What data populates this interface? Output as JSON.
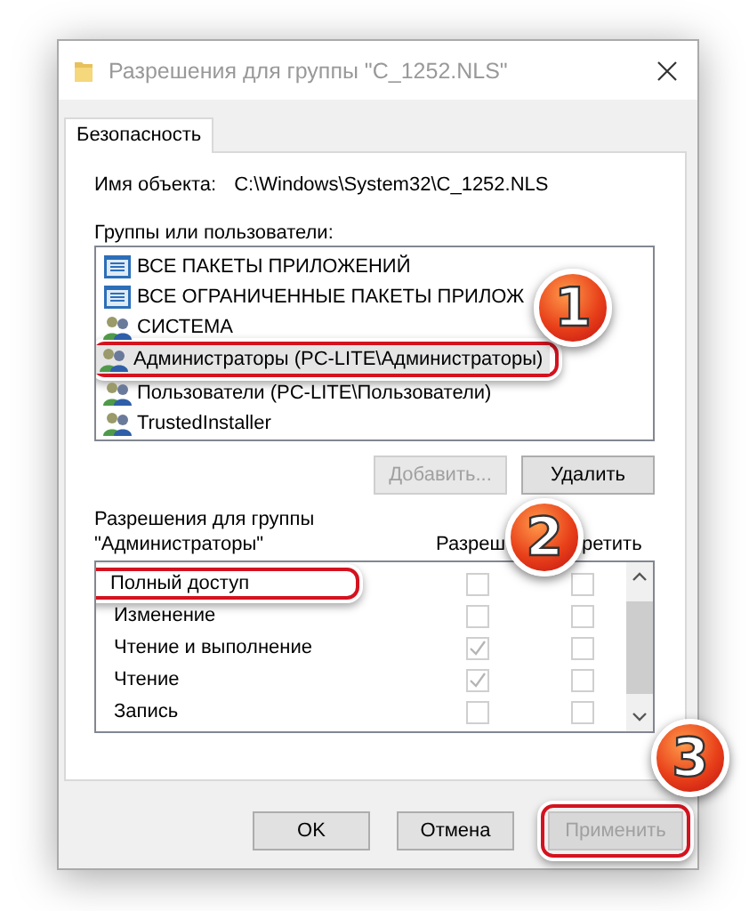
{
  "window": {
    "title": "Разрешения для группы \"C_1252.NLS\""
  },
  "tabs": [
    {
      "label": "Безопасность",
      "selected": true
    }
  ],
  "object_name": {
    "label": "Имя объекта:",
    "value": "C:\\Windows\\System32\\C_1252.NLS"
  },
  "users": {
    "label": "Группы или пользователи:",
    "items": [
      {
        "name": "ВСЕ ПАКЕТЫ ПРИЛОЖЕНИЙ",
        "kind": "package",
        "selected": false
      },
      {
        "name": "ВСЕ ОГРАНИЧЕННЫЕ ПАКЕТЫ ПРИЛОЖ",
        "kind": "package",
        "selected": false
      },
      {
        "name": "СИСТЕМА",
        "kind": "group",
        "selected": false
      },
      {
        "name": "Администраторы (PC-LITE\\Администраторы)",
        "kind": "group",
        "selected": true
      },
      {
        "name": "Пользователи (PC-LITE\\Пользователи)",
        "kind": "group",
        "selected": false
      },
      {
        "name": "TrustedInstaller",
        "kind": "group",
        "selected": false
      }
    ],
    "buttons": [
      {
        "label": "Добавить...",
        "disabled": true
      },
      {
        "label": "Удалить",
        "disabled": false
      }
    ]
  },
  "permissions": {
    "label": "Разрешения для группы \"Администраторы\"",
    "columns": [
      "Разреш",
      "ретить"
    ],
    "rows": [
      {
        "name": "Полный доступ",
        "allow": false,
        "deny": false
      },
      {
        "name": "Изменение",
        "allow": false,
        "deny": false
      },
      {
        "name": "Чтение и выполнение",
        "allow": true,
        "deny": false
      },
      {
        "name": "Чтение",
        "allow": true,
        "deny": false
      },
      {
        "name": "Запись",
        "allow": false,
        "deny": false
      }
    ]
  },
  "buttons": [
    {
      "label": "OK",
      "disabled": false
    },
    {
      "label": "Отмена",
      "disabled": false
    },
    {
      "label": "Применить",
      "disabled": true
    }
  ],
  "annotations": [
    {
      "number": "1"
    },
    {
      "number": "2"
    },
    {
      "number": "3"
    }
  ]
}
